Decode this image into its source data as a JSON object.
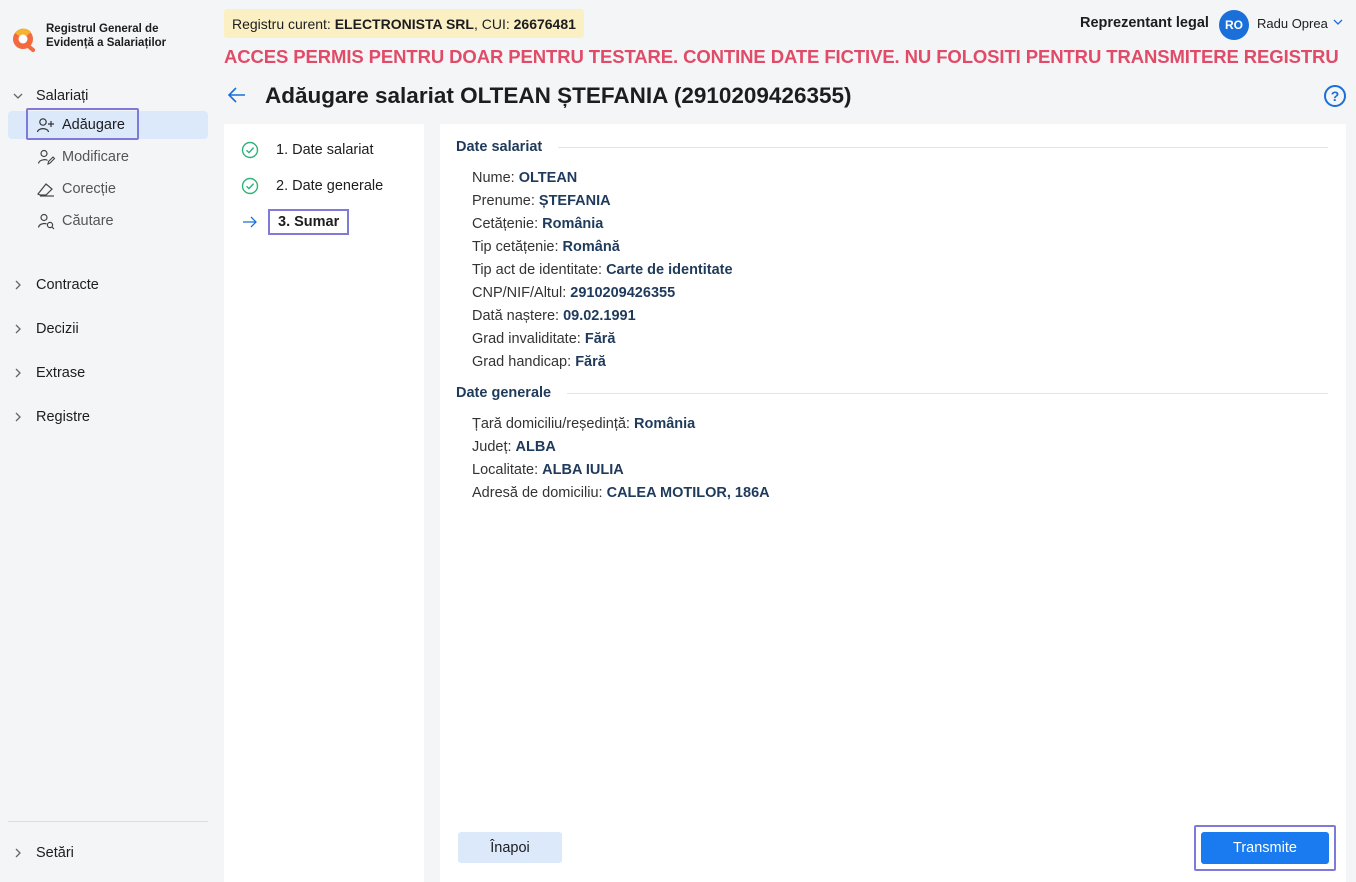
{
  "app": {
    "logo_line1": "Registrul General de",
    "logo_line2": "Evidență a Salariaților"
  },
  "sidebar": {
    "salariati": {
      "label": "Salariați",
      "items": [
        {
          "label": "Adăugare",
          "icon": "user-add-icon"
        },
        {
          "label": "Modificare",
          "icon": "user-edit-icon"
        },
        {
          "label": "Corecție",
          "icon": "eraser-icon"
        },
        {
          "label": "Căutare",
          "icon": "user-search-icon"
        }
      ]
    },
    "groups": [
      {
        "label": "Contracte"
      },
      {
        "label": "Decizii"
      },
      {
        "label": "Extrase"
      },
      {
        "label": "Registre"
      }
    ],
    "settings": {
      "label": "Setări"
    }
  },
  "topbar": {
    "registru_prefix": "Registru curent: ",
    "company": "ELECTRONISTA SRL",
    "cui_prefix": ", CUI: ",
    "cui": "26676481",
    "role": "Reprezentant legal",
    "avatar_initials": "RO",
    "user_name": "Radu Oprea",
    "warning": "ACCES PERMIS PENTRU DOAR PENTRU TESTARE. CONTINE DATE FICTIVE. NU FOLOSITI PENTRU TRANSMITERE REGISTRU"
  },
  "page": {
    "title": "Adăugare salariat OLTEAN ȘTEFANIA (2910209426355)",
    "help": "?"
  },
  "steps": [
    {
      "label": "1. Date salariat",
      "state": "done"
    },
    {
      "label": "2. Date generale",
      "state": "done"
    },
    {
      "label": "3. Sumar",
      "state": "current"
    }
  ],
  "summary": {
    "sectiune_salariat": "Date salariat",
    "salariat": [
      {
        "label": "Nume: ",
        "value": "OLTEAN"
      },
      {
        "label": "Prenume: ",
        "value": "ȘTEFANIA"
      },
      {
        "label": "Cetățenie: ",
        "value": "România"
      },
      {
        "label": "Tip cetățenie: ",
        "value": "Română"
      },
      {
        "label": "Tip act de identitate: ",
        "value": "Carte de identitate"
      },
      {
        "label": "CNP/NIF/Altul: ",
        "value": "2910209426355"
      },
      {
        "label": "Dată naștere: ",
        "value": "09.02.1991"
      },
      {
        "label": "Grad invaliditate: ",
        "value": "Fără"
      },
      {
        "label": "Grad handicap: ",
        "value": "Fără"
      }
    ],
    "sectiune_generale": "Date generale",
    "generale": [
      {
        "label": "Țară domiciliu/reședință: ",
        "value": "România"
      },
      {
        "label": "Județ: ",
        "value": "ALBA"
      },
      {
        "label": "Localitate: ",
        "value": "ALBA IULIA"
      },
      {
        "label": "Adresă de domiciliu: ",
        "value": "CALEA MOTILOR, 186A"
      }
    ]
  },
  "actions": {
    "back_label": "Înapoi",
    "submit_label": "Transmite"
  },
  "colors": {
    "accent": "#1a7af0",
    "warning": "#e04b68",
    "success": "#2fb37a",
    "highlight_box": "#7f7ad8",
    "registru_bg": "#fbf0c4"
  }
}
